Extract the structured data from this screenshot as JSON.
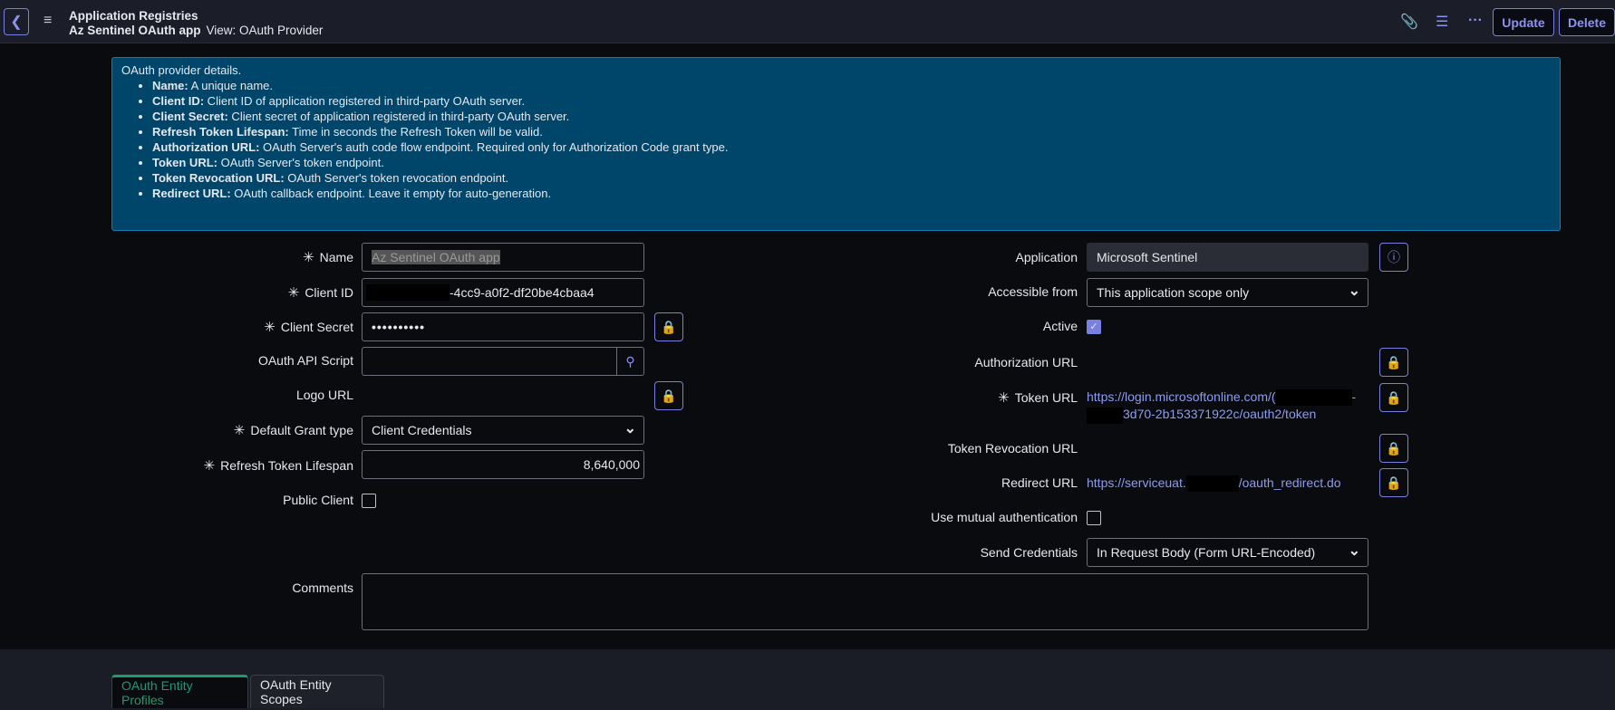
{
  "header": {
    "breadcrumb": "Application Registries",
    "record_name": "Az Sentinel OAuth app",
    "view_label": "View: OAuth Provider",
    "update_label": "Update",
    "delete_label": "Delete"
  },
  "info": {
    "intro": "OAuth provider details.",
    "items": [
      {
        "term": "Name:",
        "desc": " A unique name."
      },
      {
        "term": "Client ID:",
        "desc": " Client ID of application registered in third-party OAuth server."
      },
      {
        "term": "Client Secret:",
        "desc": " Client secret of application registered in third-party OAuth server."
      },
      {
        "term": "Refresh Token Lifespan:",
        "desc": " Time in seconds the Refresh Token will be valid."
      },
      {
        "term": "Authorization URL:",
        "desc": " OAuth Server's auth code flow endpoint. Required only for Authorization Code grant type."
      },
      {
        "term": "Token URL:",
        "desc": " OAuth Server's token endpoint."
      },
      {
        "term": "Token Revocation URL:",
        "desc": " OAuth Server's token revocation endpoint."
      },
      {
        "term": "Redirect URL:",
        "desc": " OAuth callback endpoint. Leave it empty for auto-generation."
      }
    ]
  },
  "left": {
    "required_mark": "✳",
    "name_label": "Name",
    "name_value": "Az Sentinel OAuth app",
    "client_id_label": "Client ID",
    "client_id_value": "-4cc9-a0f2-df20be4cbaa4",
    "client_secret_label": "Client Secret",
    "client_secret_value": "••••••••••",
    "api_script_label": "OAuth API Script",
    "logo_url_label": "Logo URL",
    "grant_label": "Default Grant type",
    "grant_value": "Client Credentials",
    "refresh_label": "Refresh Token Lifespan",
    "refresh_value": "8,640,000",
    "public_label": "Public Client"
  },
  "right": {
    "application_label": "Application",
    "application_value": "Microsoft Sentinel",
    "accessible_label": "Accessible from",
    "accessible_value": "This application scope only",
    "active_label": "Active",
    "active_checked": true,
    "auth_url_label": "Authorization URL",
    "token_url_label": "Token URL",
    "token_url_part1": "https://login.microsoftonline.com/(",
    "token_url_part2": "-",
    "token_url_part3": "3d70-2b153371922c/oauth2/token",
    "revocation_label": "Token Revocation URL",
    "redirect_label": "Redirect URL",
    "redirect_part1": "https://serviceuat.",
    "redirect_part2": "/oauth_redirect.do",
    "mutual_label": "Use mutual authentication",
    "send_label": "Send Credentials",
    "send_value": "In Request Body (Form URL-Encoded)"
  },
  "comments_label": "Comments",
  "tabs": [
    {
      "label": "OAuth Entity Profiles",
      "active": true
    },
    {
      "label": "OAuth Entity Scopes",
      "active": false
    }
  ],
  "colors": {
    "accent": "#7a80e0",
    "info_bg": "#00456a",
    "tab_active": "#1f9a6e"
  }
}
